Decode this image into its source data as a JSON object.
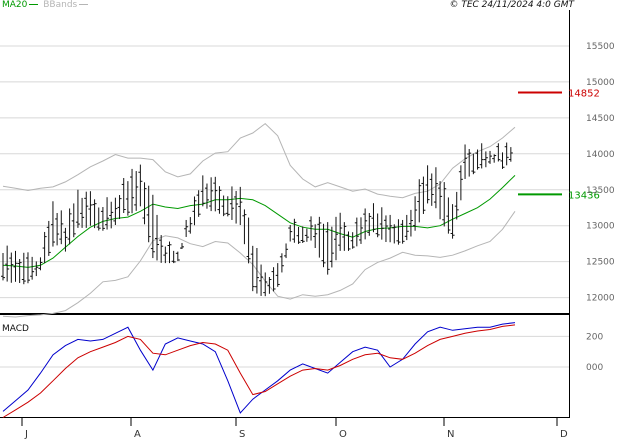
{
  "header": {
    "legend_ma": "MA20",
    "legend_bb": "BBands",
    "copyright": "© TEC 24/11/2024 4:0 GMT",
    "macd_label": "MACD"
  },
  "colors": {
    "background": "#ffffff",
    "grid": "#d8d8d8",
    "price_bars": "#111111",
    "ma": "#009900",
    "bbands": "#b5b5b5",
    "macd": "#0000cc",
    "signal": "#cc0000",
    "level_red": "#cc0000",
    "level_green": "#009900"
  },
  "chart_data": [
    {
      "type": "ohlc",
      "title": "",
      "y_ticks": [
        12000,
        12500,
        13000,
        13500,
        14000,
        14500,
        15000,
        15500
      ],
      "y_tick_labels": [
        "12000",
        "12500",
        "13000",
        "13500",
        "14000",
        "14500",
        "15000",
        "15500"
      ],
      "ylim": [
        11800,
        16000
      ],
      "x_months": [
        "J",
        "A",
        "S",
        "O",
        "N",
        "D"
      ],
      "reference_levels": [
        {
          "value": 14852,
          "label": "14852",
          "color": "#cc0000"
        },
        {
          "value": 13436,
          "label": "13436",
          "color": "#009900"
        }
      ],
      "series": [
        {
          "name": "MA20",
          "color": "#009900",
          "values": [
            12450,
            12440,
            12420,
            12450,
            12550,
            12700,
            12850,
            12980,
            13060,
            13100,
            13120,
            13200,
            13300,
            13260,
            13240,
            13280,
            13300,
            13360,
            13360,
            13380,
            13360,
            13280,
            13160,
            13040,
            12980,
            12950,
            12950,
            12890,
            12840,
            12920,
            12960,
            12970,
            12990,
            12990,
            12970,
            13000,
            13090,
            13170,
            13250,
            13370,
            13530,
            13700
          ]
        },
        {
          "name": "BBands",
          "color": "#b5b5b5",
          "values": [
            11740,
            11730,
            11750,
            11760,
            11780,
            11820,
            11930,
            12060,
            12220,
            12240,
            12290,
            12510,
            12790,
            12860,
            12830,
            12750,
            12710,
            12780,
            12760,
            12620,
            12460,
            12230,
            12020,
            11980,
            12040,
            12020,
            12040,
            12100,
            12190,
            12390,
            12490,
            12550,
            12630,
            12590,
            12580,
            12560,
            12590,
            12650,
            12720,
            12780,
            12950,
            13200
          ]
        },
        {
          "name": "BBands",
          "color": "#b5b5b5",
          "values": [
            13550,
            13520,
            13490,
            13520,
            13540,
            13610,
            13710,
            13820,
            13900,
            13990,
            13940,
            13940,
            13920,
            13750,
            13680,
            13720,
            13900,
            14010,
            14030,
            14220,
            14290,
            14420,
            14250,
            13840,
            13650,
            13540,
            13600,
            13540,
            13480,
            13510,
            13440,
            13410,
            13390,
            13450,
            13480,
            13580,
            13800,
            13930,
            14030,
            14100,
            14220,
            14370
          ]
        }
      ],
      "ohlc_highs": [
        12700,
        12650,
        12550,
        12600,
        13300,
        13050,
        13500,
        13400,
        13300,
        13350,
        13700,
        13850,
        13350,
        12750,
        12600,
        13200,
        13700,
        13600,
        13450,
        13500,
        12800,
        12350,
        12400,
        13050,
        12950,
        13100,
        13050,
        13100,
        12950,
        13200,
        13250,
        13150,
        13000,
        13450,
        13800,
        13700,
        13300,
        14050,
        14100,
        14000,
        14100,
        14150
      ],
      "ohlc_lows": [
        12300,
        12250,
        12200,
        12350,
        12650,
        12700,
        13000,
        13000,
        12900,
        12950,
        13200,
        13300,
        12550,
        12450,
        12450,
        12950,
        13300,
        13200,
        13100,
        12950,
        12150,
        12050,
        12150,
        12750,
        12700,
        12750,
        12350,
        12650,
        12650,
        12750,
        12900,
        12800,
        12750,
        12900,
        13250,
        13150,
        12850,
        13650,
        13750,
        13800,
        13850,
        14000
      ]
    },
    {
      "type": "line",
      "title": "",
      "y_ticks": [
        0,
        200
      ],
      "y_tick_labels": [
        "000",
        "200"
      ],
      "ylim": [
        -320,
        320
      ],
      "series": [
        {
          "name": "MACD",
          "color": "#0000cc",
          "values": [
            -290,
            -220,
            -150,
            -40,
            80,
            140,
            180,
            170,
            180,
            220,
            260,
            110,
            -20,
            150,
            190,
            170,
            150,
            100,
            -90,
            -300,
            -210,
            -150,
            -90,
            -20,
            20,
            -10,
            -40,
            30,
            100,
            130,
            110,
            0,
            50,
            150,
            230,
            260,
            240,
            250,
            260,
            260,
            280,
            290
          ]
        },
        {
          "name": "Signal",
          "color": "#cc0000",
          "values": [
            -330,
            -280,
            -230,
            -170,
            -90,
            -10,
            60,
            100,
            130,
            160,
            200,
            180,
            90,
            80,
            110,
            140,
            160,
            150,
            110,
            -40,
            -180,
            -160,
            -110,
            -60,
            -20,
            -10,
            -20,
            10,
            50,
            80,
            90,
            60,
            50,
            90,
            140,
            180,
            200,
            220,
            235,
            245,
            265,
            275
          ]
        }
      ]
    }
  ]
}
